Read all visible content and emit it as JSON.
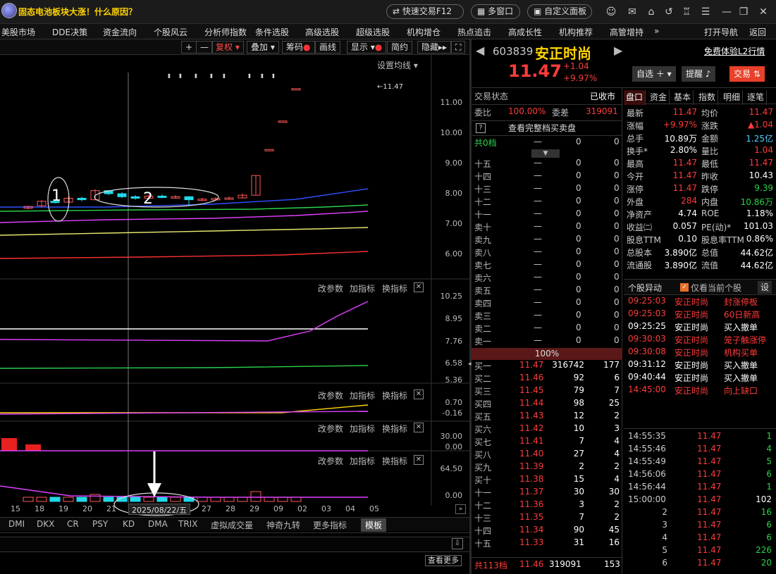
{
  "titlebar": {
    "news": "固态电池板块大涨！什么原因？",
    "quick_trade": "快速交易F12",
    "multi_window": "多窗口",
    "custom_panel": "自定义面板"
  },
  "menu": [
    "美股市场",
    "DDE决策",
    "资金流向",
    "个股风云",
    "分析师指数",
    "条件选股",
    "高级选股",
    "超级选股",
    "机构增仓",
    "热点追击",
    "高成长性",
    "机构推荐",
    "高管增持",
    "打开导航",
    "返回"
  ],
  "menu_more": "»",
  "toolbar": {
    "plus": "+",
    "minus": "—",
    "fuquan": "复权",
    "diejia": "叠加",
    "chouma": "筹码",
    "huaxian": "画线",
    "xianshi": "显示",
    "jianyue": "简约",
    "yincang": "隐藏"
  },
  "chart": {
    "ma_setting": "设置均线",
    "price_axis": [
      "11.00",
      "10.00",
      "9.00",
      "8.00",
      "7.00",
      "6.00"
    ],
    "last_price_label": "11.47",
    "annotations": [
      "1",
      "2"
    ],
    "panel_btns": [
      "改参数",
      "加指标",
      "换指标"
    ],
    "p2_axis": [
      "10.25",
      "8.95",
      "7.76",
      "6.58",
      "5.36"
    ],
    "p3_axis": [
      "0.70",
      "-0.16"
    ],
    "p4_axis": [
      "30.00",
      "0.00"
    ],
    "p5_axis": [
      "64.50",
      "0.00"
    ],
    "days": [
      "15",
      "18",
      "19",
      "20",
      "21",
      "27",
      "28",
      "29",
      "09",
      "02",
      "03",
      "04",
      "05"
    ],
    "cursor_date": "2025/08/22/五",
    "candles": [
      {
        "o": 7.52,
        "c": 7.58,
        "h": 7.6,
        "l": 7.48
      },
      {
        "o": 7.6,
        "c": 7.75,
        "h": 7.78,
        "l": 7.55
      },
      {
        "o": 7.75,
        "c": 7.72,
        "h": 7.8,
        "l": 7.68
      },
      {
        "o": 7.72,
        "c": 7.85,
        "h": 7.9,
        "l": 7.7
      },
      {
        "o": 7.85,
        "c": 7.8,
        "h": 7.9,
        "l": 7.75
      },
      {
        "o": 7.8,
        "c": 8.1,
        "h": 8.15,
        "l": 7.78
      },
      {
        "o": 8.1,
        "c": 8.0,
        "h": 8.12,
        "l": 7.95
      },
      {
        "o": 8.0,
        "c": 7.9,
        "h": 8.05,
        "l": 7.85
      },
      {
        "o": 7.9,
        "c": 7.85,
        "h": 7.95,
        "l": 7.8
      },
      {
        "o": 7.85,
        "c": 7.92,
        "h": 7.96,
        "l": 7.82
      },
      {
        "o": 7.92,
        "c": 7.88,
        "h": 7.98,
        "l": 7.85
      },
      {
        "o": 7.88,
        "c": 7.9,
        "h": 7.95,
        "l": 7.84
      },
      {
        "o": 7.9,
        "c": 7.8,
        "h": 7.92,
        "l": 7.62
      },
      {
        "o": 7.8,
        "c": 7.82,
        "h": 7.86,
        "l": 7.76
      },
      {
        "o": 7.82,
        "c": 7.84,
        "h": 7.88,
        "l": 7.8
      },
      {
        "o": 7.84,
        "c": 7.86,
        "h": 7.9,
        "l": 7.82
      },
      {
        "o": 7.86,
        "c": 7.95,
        "h": 8.0,
        "l": 7.84
      },
      {
        "o": 7.95,
        "c": 8.6,
        "h": 8.6,
        "l": 7.95
      },
      {
        "o": 9.46,
        "c": 9.46,
        "h": 9.46,
        "l": 9.46
      },
      {
        "o": 10.4,
        "c": 10.4,
        "h": 10.4,
        "l": 10.4
      },
      {
        "o": 11.47,
        "c": 11.47,
        "h": 11.47,
        "l": 11.47
      }
    ]
  },
  "bottom_tabs": [
    "DMI",
    "DKX",
    "CR",
    "PSY",
    "KD",
    "DMA",
    "TRIX",
    "虚拟成交量",
    "神奇九转",
    "更多指标",
    "模板"
  ],
  "bottom": {
    "view_more": "查看更多"
  },
  "stock": {
    "code": "603839",
    "name": "安正时尚",
    "price": "11.47",
    "change": "+1.04",
    "pct": "+9.97%",
    "l2": "免费体验L2行情",
    "zixuan": "自选",
    "tixing": "提醒",
    "jiaoyi": "交易"
  },
  "status": {
    "label": "交易状态",
    "value": "已收市",
    "weibi_label": "委比",
    "weibi": "100.00%",
    "weicha_label": "委差",
    "weicha": "319091",
    "full_book": "查看完整档买卖盘",
    "total_asks": "共0档",
    "total_asks_vol": "0",
    "total_asks_cnt": "0"
  },
  "asks": [
    "十五",
    "十四",
    "十三",
    "十二",
    "十一",
    "卖十",
    "卖九",
    "卖八",
    "卖七",
    "卖六",
    "卖五",
    "卖四",
    "卖三",
    "卖二",
    "卖一"
  ],
  "ask_empty": "—",
  "ask_zero": "0",
  "ratio_bar": "100%",
  "bids": [
    {
      "n": "买一",
      "p": "11.47",
      "v": "316742",
      "c": "177"
    },
    {
      "n": "买二",
      "p": "11.46",
      "v": "92",
      "c": "6"
    },
    {
      "n": "买三",
      "p": "11.45",
      "v": "79",
      "c": "7"
    },
    {
      "n": "买四",
      "p": "11.44",
      "v": "98",
      "c": "25"
    },
    {
      "n": "买五",
      "p": "11.43",
      "v": "12",
      "c": "2"
    },
    {
      "n": "买六",
      "p": "11.42",
      "v": "10",
      "c": "3"
    },
    {
      "n": "买七",
      "p": "11.41",
      "v": "7",
      "c": "4"
    },
    {
      "n": "买八",
      "p": "11.40",
      "v": "27",
      "c": "4"
    },
    {
      "n": "买九",
      "p": "11.39",
      "v": "2",
      "c": "2"
    },
    {
      "n": "买十",
      "p": "11.38",
      "v": "15",
      "c": "4"
    },
    {
      "n": "十一",
      "p": "11.37",
      "v": "30",
      "c": "30"
    },
    {
      "n": "十二",
      "p": "11.36",
      "v": "3",
      "c": "2"
    },
    {
      "n": "十三",
      "p": "11.35",
      "v": "7",
      "c": "2"
    },
    {
      "n": "十四",
      "p": "11.34",
      "v": "90",
      "c": "45"
    },
    {
      "n": "十五",
      "p": "11.33",
      "v": "31",
      "c": "16"
    }
  ],
  "bid_total": {
    "n": "共113档",
    "p": "11.46",
    "v": "319091",
    "c": "153"
  },
  "info_tabs": [
    "盘口",
    "资金",
    "基本",
    "指数",
    "明细",
    "逐笔"
  ],
  "info": [
    [
      "最新",
      "11.47",
      "red",
      "均价",
      "11.47",
      "red"
    ],
    [
      "涨幅",
      "+9.97%",
      "red",
      "涨跌",
      "▲1.04",
      "red"
    ],
    [
      "总手",
      "10.89万",
      "white",
      "金额",
      "1.25亿",
      "cyan"
    ],
    [
      "换手*",
      "2.80%",
      "white",
      "量比",
      "1.04",
      "red"
    ],
    [
      "最高",
      "11.47",
      "red",
      "最低",
      "11.47",
      "red"
    ],
    [
      "今开",
      "11.47",
      "red",
      "昨收",
      "10.43",
      "white"
    ],
    [
      "涨停",
      "11.47",
      "red",
      "跌停",
      "9.39",
      "green"
    ],
    [
      "外盘",
      "284",
      "red",
      "内盘",
      "10.86万",
      "green"
    ],
    [
      "净资产",
      "4.74",
      "white",
      "ROE",
      "1.18%",
      "white"
    ],
    [
      "收益㈡",
      "0.057",
      "white",
      "PE(动)*",
      "101.03",
      "white"
    ],
    [
      "股息TTM",
      "0.10",
      "white",
      "股息率TTM",
      "0.86%",
      "white"
    ],
    [
      "总股本",
      "3.890亿",
      "white",
      "总值",
      "44.62亿",
      "white"
    ],
    [
      "流通股",
      "3.890亿",
      "white",
      "流值",
      "44.62亿",
      "white"
    ]
  ],
  "anomaly": {
    "title": "个股异动",
    "only_current": "仅看当前个股",
    "setting": "设",
    "rows": [
      {
        "t": "09:25:03",
        "n": "安正时尚",
        "e": "封涨停板",
        "c": "red"
      },
      {
        "t": "09:25:03",
        "n": "安正时尚",
        "e": "60日新高",
        "c": "red"
      },
      {
        "t": "09:25:25",
        "n": "安正时尚",
        "e": "买入撤单",
        "c": "white"
      },
      {
        "t": "09:30:03",
        "n": "安正时尚",
        "e": "笼子触涨停",
        "c": "red"
      },
      {
        "t": "09:30:08",
        "n": "安正时尚",
        "e": "机构买单",
        "c": "red"
      },
      {
        "t": "09:31:12",
        "n": "安正时尚",
        "e": "买入撤单",
        "c": "white"
      },
      {
        "t": "09:40:44",
        "n": "安正时尚",
        "e": "买入撤单",
        "c": "white"
      },
      {
        "t": "14:45:00",
        "n": "安正时尚",
        "e": "向上缺口",
        "c": "red"
      }
    ]
  },
  "ticks": [
    {
      "t": "14:55:35",
      "p": "11.47",
      "v": "1"
    },
    {
      "t": "14:55:46",
      "p": "11.47",
      "v": "4"
    },
    {
      "t": "14:55:49",
      "p": "11.47",
      "v": "5"
    },
    {
      "t": "14:56:06",
      "p": "11.47",
      "v": "6"
    },
    {
      "t": "14:56:44",
      "p": "11.47",
      "v": "1"
    },
    {
      "t": "15:00:00",
      "p": "11.47",
      "v": "102"
    },
    {
      "t": "2",
      "p": "11.47",
      "v": "16"
    },
    {
      "t": "3",
      "p": "11.47",
      "v": "6"
    },
    {
      "t": "4",
      "p": "11.47",
      "v": "6"
    },
    {
      "t": "5",
      "p": "11.47",
      "v": "226"
    },
    {
      "t": "6",
      "p": "11.47",
      "v": "20"
    }
  ]
}
